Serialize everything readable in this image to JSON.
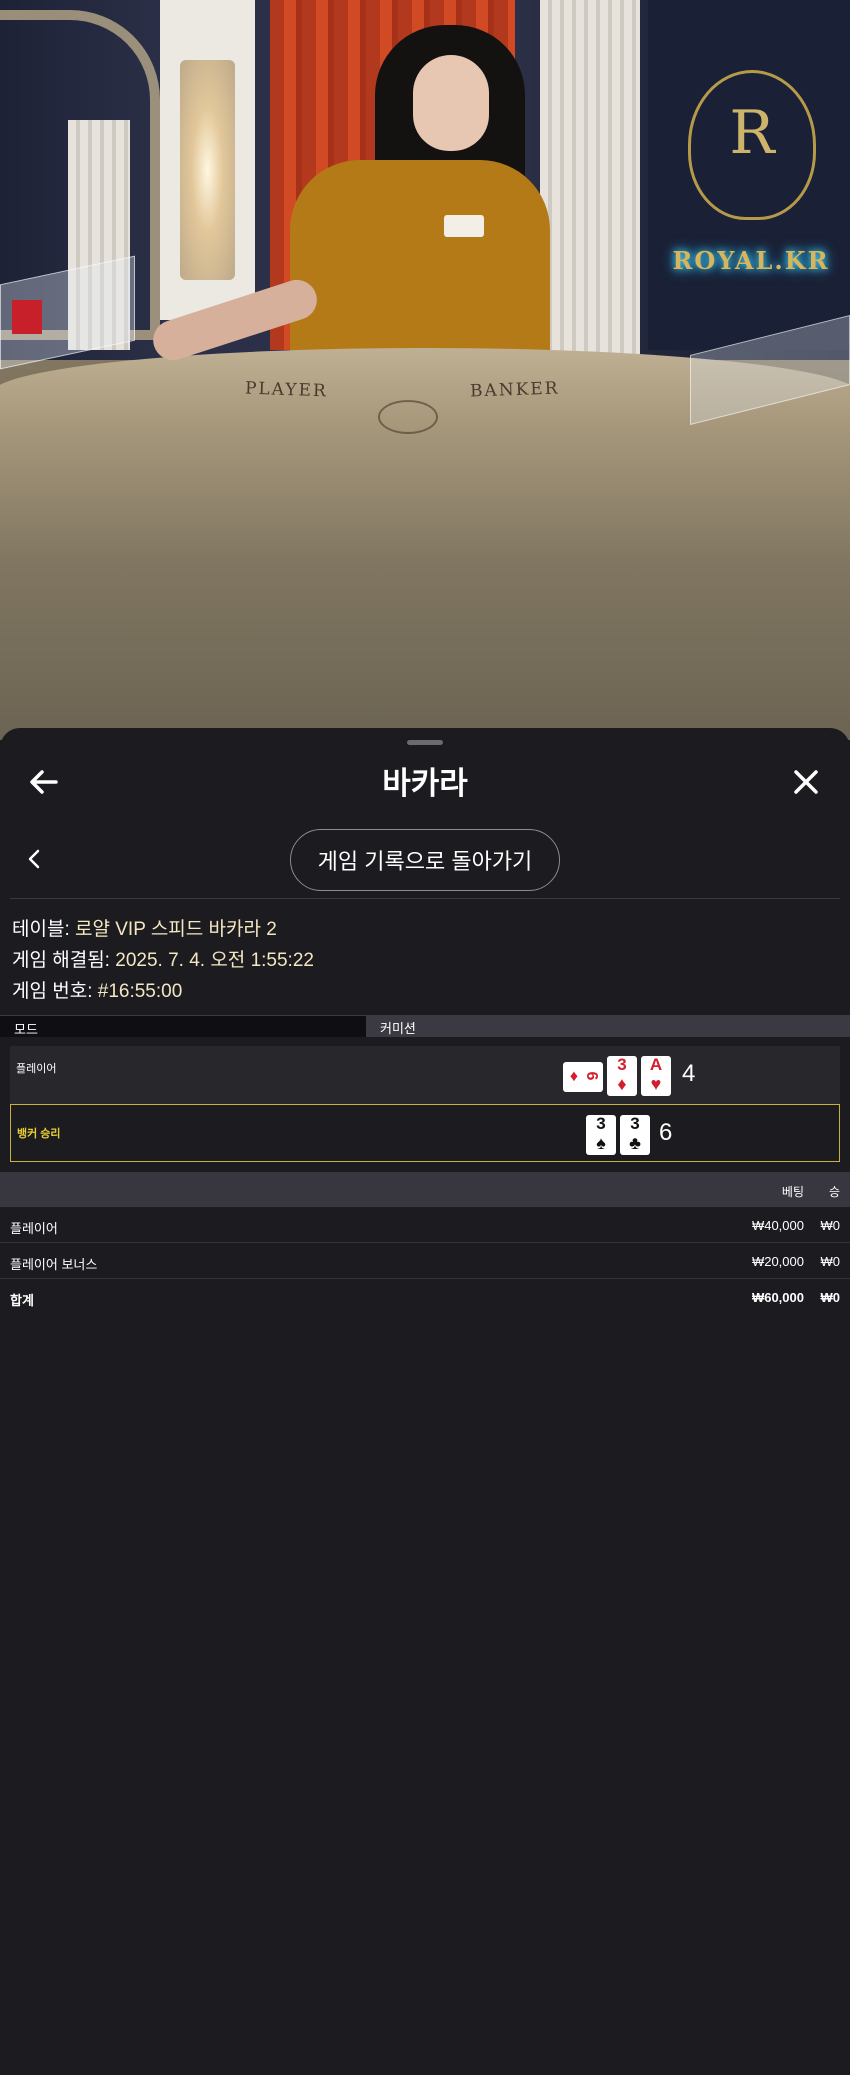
{
  "video": {
    "brand_text": "ROYAL.KR",
    "crest_letter": "R",
    "felt_player": "PLAYER",
    "felt_banker": "BANKER"
  },
  "header": {
    "title": "바카라",
    "back_icon": "arrow-left-icon",
    "close_icon": "close-icon"
  },
  "history_button_label": "게임 기록으로 돌아가기",
  "info": {
    "table_label": "테이블:",
    "table_value": "로얄 VIP 스피드 바카라 2",
    "resolved_label": "게임 해결됨:",
    "resolved_value": "2025. 7. 4. 오전 1:55:22",
    "number_label": "게임 번호:",
    "number_value": "#16:55:00"
  },
  "mode": {
    "left": "모드",
    "right": "커미션"
  },
  "results": {
    "player": {
      "label": "플레이어",
      "cards": [
        {
          "rank": "6",
          "suit": "♦",
          "color": "red",
          "rotated": true
        },
        {
          "rank": "3",
          "suit": "♦",
          "color": "red",
          "rotated": false
        },
        {
          "rank": "A",
          "suit": "♥",
          "color": "red",
          "rotated": false
        }
      ],
      "score": "4"
    },
    "banker": {
      "label": "뱅커 승리",
      "cards": [
        {
          "rank": "3",
          "suit": "♠",
          "color": "black",
          "rotated": false
        },
        {
          "rank": "3",
          "suit": "♣",
          "color": "black",
          "rotated": false
        }
      ],
      "score": "6"
    }
  },
  "bets": {
    "headers": {
      "bet": "베팅",
      "win": "승"
    },
    "rows": [
      {
        "name": "플레이어",
        "amount": "₩40,000",
        "win": "₩0"
      },
      {
        "name": "플레이어 보너스",
        "amount": "₩20,000",
        "win": "₩0"
      },
      {
        "name": "합계",
        "amount": "₩60,000",
        "win": "₩0"
      }
    ]
  },
  "colors": {
    "sheet_bg": "#1c1b1f",
    "winner_border": "#c9b23c",
    "winner_text": "#e7cd35",
    "info_value": "#f4e7c2"
  }
}
